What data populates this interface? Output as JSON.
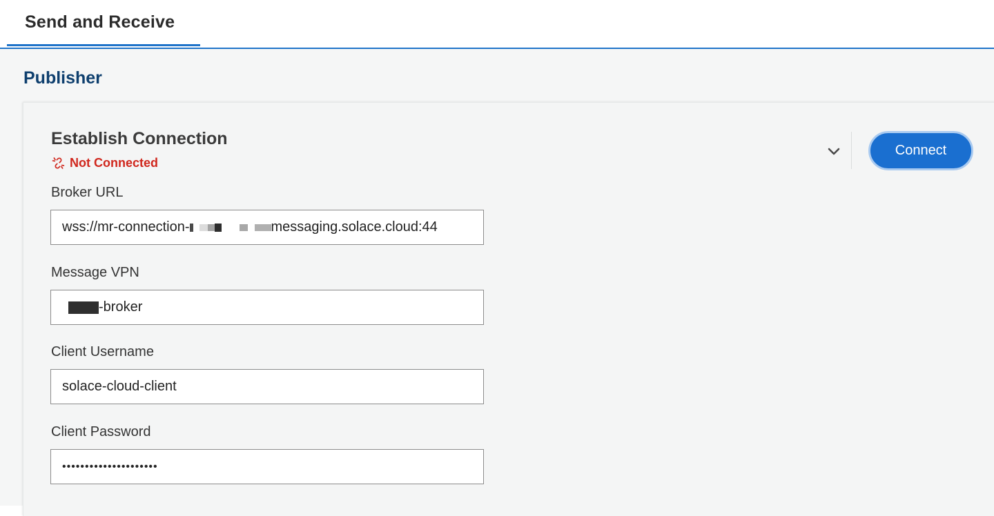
{
  "tabs": [
    {
      "label": "Send and Receive",
      "active": true
    }
  ],
  "section": {
    "title": "Publisher"
  },
  "connection_card": {
    "title": "Establish Connection",
    "status": {
      "text": "Not Connected",
      "icon": "broken-link-icon",
      "color": "#d0271d"
    },
    "expand_icon": "chevron-down-icon",
    "connect_label": "Connect"
  },
  "fields": {
    "broker_url": {
      "label": "Broker URL",
      "value_prefix": "wss://mr-connection-",
      "value_suffix": "messaging.solace.cloud:44"
    },
    "message_vpn": {
      "label": "Message VPN",
      "value_suffix": "-broker"
    },
    "client_username": {
      "label": "Client Username",
      "value": "solace-cloud-client"
    },
    "client_password": {
      "label": "Client Password",
      "value": "•••••••••••••••••••••"
    }
  },
  "colors": {
    "accent": "#1f73c9",
    "button": "#1a6fd0",
    "section_title": "#0e3f6e",
    "error": "#d0271d",
    "page_bg": "#f5f6f6"
  }
}
